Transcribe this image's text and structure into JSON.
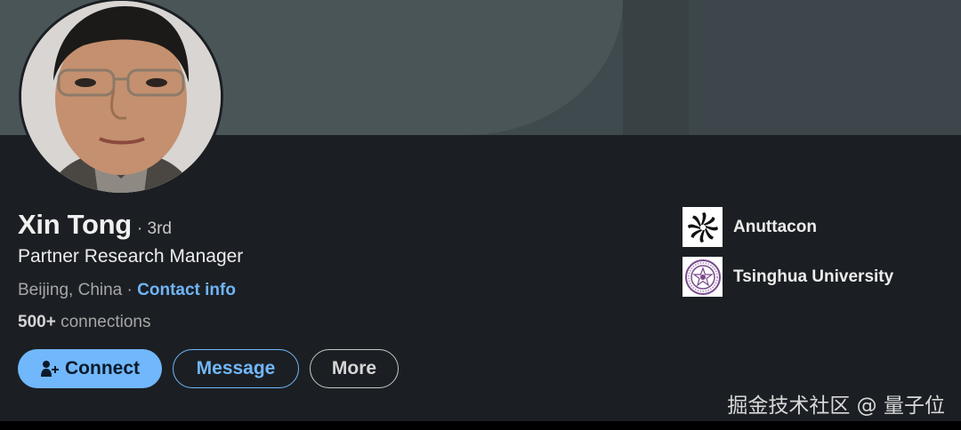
{
  "profile": {
    "name": "Xin Tong",
    "degree": "· 3rd",
    "headline": "Partner Research Manager",
    "location": "Beijing, China",
    "separator": " · ",
    "contact_label": "Contact info",
    "connections_count": "500+",
    "connections_label": " connections"
  },
  "actions": {
    "connect": "Connect",
    "message": "Message",
    "more": "More"
  },
  "orgs": [
    {
      "name": "Anuttacon",
      "icon": "anuttacon-logo"
    },
    {
      "name": "Tsinghua University",
      "icon": "tsinghua-seal"
    }
  ],
  "watermark": "掘金技术社区 @ 量子位",
  "colors": {
    "accent": "#71b7fb",
    "background": "#1b1f23"
  }
}
